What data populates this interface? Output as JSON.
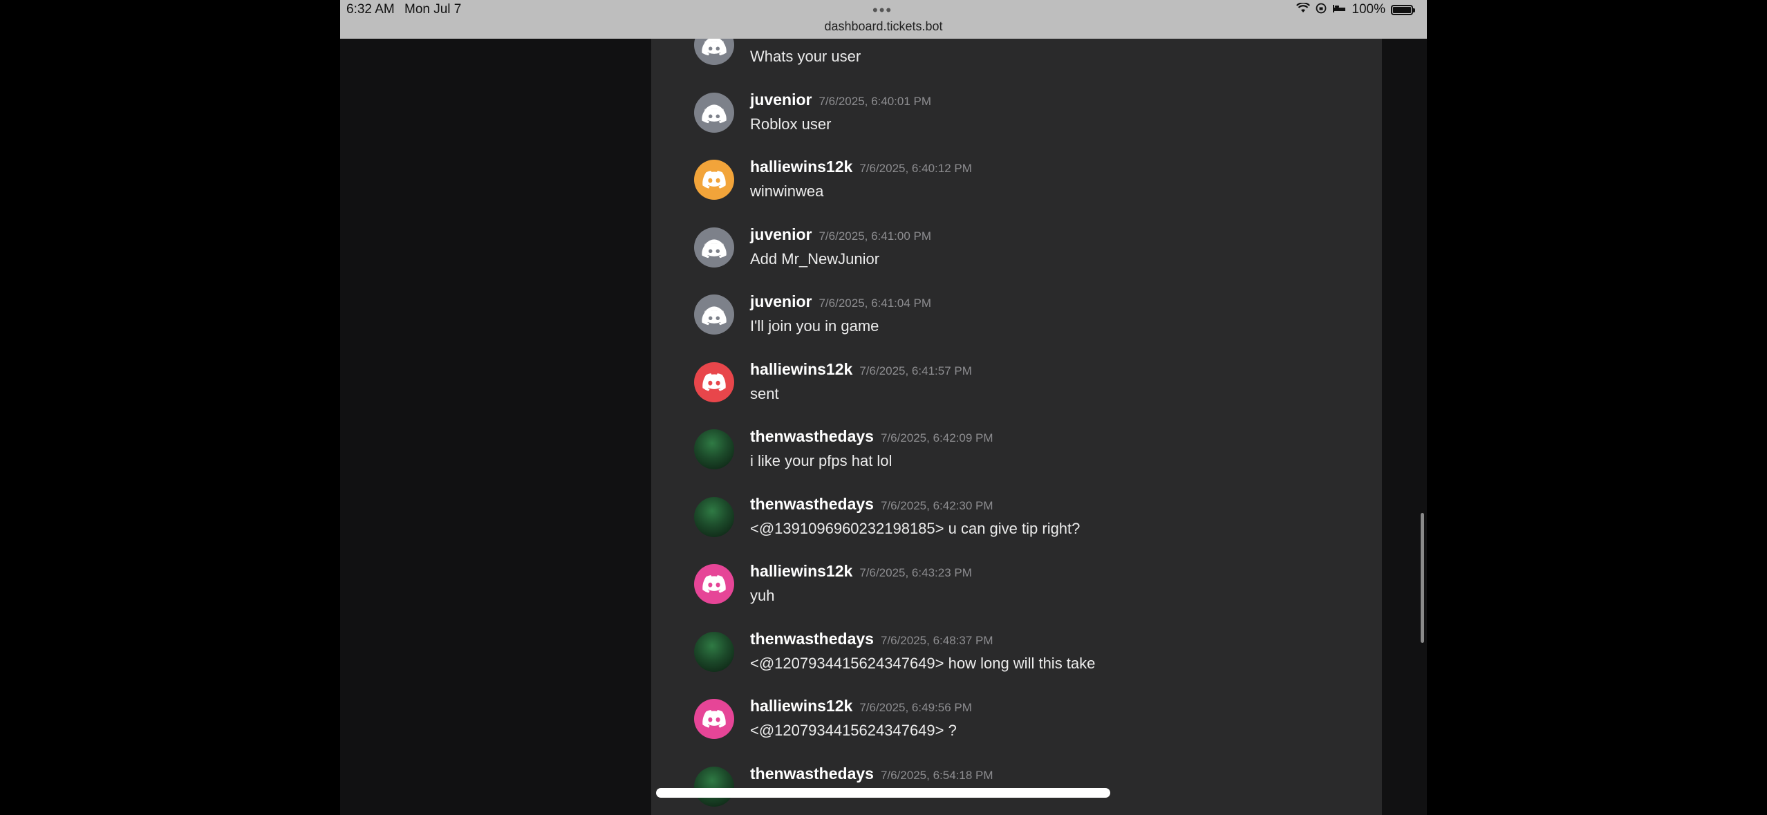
{
  "status_bar": {
    "time": "6:32 AM",
    "date": "Mon Jul 7",
    "url": "dashboard.tickets.bot",
    "battery": "100%"
  },
  "colors": {
    "avatar_grey": "#7d818a",
    "avatar_orange": "#f2a43a",
    "avatar_red": "#e8464b",
    "avatar_pink": "#e64597",
    "panel_bg": "#2a2a2b",
    "page_bg": "#111112"
  },
  "messages": [
    {
      "author": "",
      "timestamp": "",
      "text": "Whats your user",
      "avatar": "discord-grey"
    },
    {
      "author": "juvenior",
      "timestamp": "7/6/2025, 6:40:01 PM",
      "text": "Roblox user",
      "avatar": "discord-grey"
    },
    {
      "author": "halliewins12k",
      "timestamp": "7/6/2025, 6:40:12 PM",
      "text": "winwinwea",
      "avatar": "discord-orange"
    },
    {
      "author": "juvenior",
      "timestamp": "7/6/2025, 6:41:00 PM",
      "text": "Add Mr_NewJunior",
      "avatar": "discord-grey"
    },
    {
      "author": "juvenior",
      "timestamp": "7/6/2025, 6:41:04 PM",
      "text": "I'll join you in game",
      "avatar": "discord-grey"
    },
    {
      "author": "halliewins12k",
      "timestamp": "7/6/2025, 6:41:57 PM",
      "text": "sent",
      "avatar": "discord-red"
    },
    {
      "author": "thenwasthedays",
      "timestamp": "7/6/2025, 6:42:09 PM",
      "text": "i like your pfps hat lol",
      "avatar": "photo"
    },
    {
      "author": "thenwasthedays",
      "timestamp": "7/6/2025, 6:42:30 PM",
      "text": "<@1391096960232198185> u can give tip right?",
      "avatar": "photo"
    },
    {
      "author": "halliewins12k",
      "timestamp": "7/6/2025, 6:43:23 PM",
      "text": "yuh",
      "avatar": "discord-pink"
    },
    {
      "author": "thenwasthedays",
      "timestamp": "7/6/2025, 6:48:37 PM",
      "text": "<@1207934415624347649> how long will this take",
      "avatar": "photo"
    },
    {
      "author": "halliewins12k",
      "timestamp": "7/6/2025, 6:49:56 PM",
      "text": "<@1207934415624347649> ?",
      "avatar": "discord-pink"
    },
    {
      "author": "thenwasthedays",
      "timestamp": "7/6/2025, 6:54:18 PM",
      "text": "",
      "avatar": "photo"
    }
  ]
}
